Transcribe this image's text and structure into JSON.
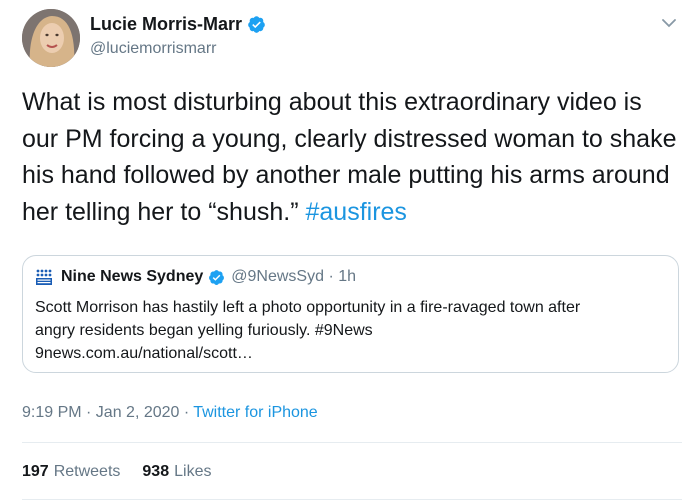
{
  "author": {
    "display_name": "Lucie Morris-Marr",
    "handle": "@luciemorrismarr",
    "verified_icon": "verified-badge-icon"
  },
  "tweet": {
    "text": "What is most disturbing about this extraordinary video is our PM forcing a young, clearly distressed woman to shake his hand followed by another male putting his arms around her telling her to “shush.”",
    "hashtag": "#ausfires"
  },
  "quoted_tweet": {
    "logo_icon": "nine-news-logo-icon",
    "display_name": "Nine News Sydney",
    "handle_and_time": "@9NewsSyd · 1h",
    "text_line1": "Scott Morrison has hastily left a photo opportunity in a fire-ravaged town after",
    "text_line2": "angry residents began yelling furiously. #9News",
    "link": "9news.com.au/national/scott…"
  },
  "meta": {
    "timestamp": "9:19 PM · Jan 2, 2020 ·",
    "source": "Twitter for iPhone"
  },
  "stats": {
    "retweets_count": "197",
    "retweets_label": "Retweets",
    "likes_count": "938",
    "likes_label": "Likes"
  },
  "colors": {
    "link_blue": "#1b95e0",
    "secondary_text": "#657786",
    "primary_text": "#14171a",
    "border": "#ccd6dd"
  }
}
